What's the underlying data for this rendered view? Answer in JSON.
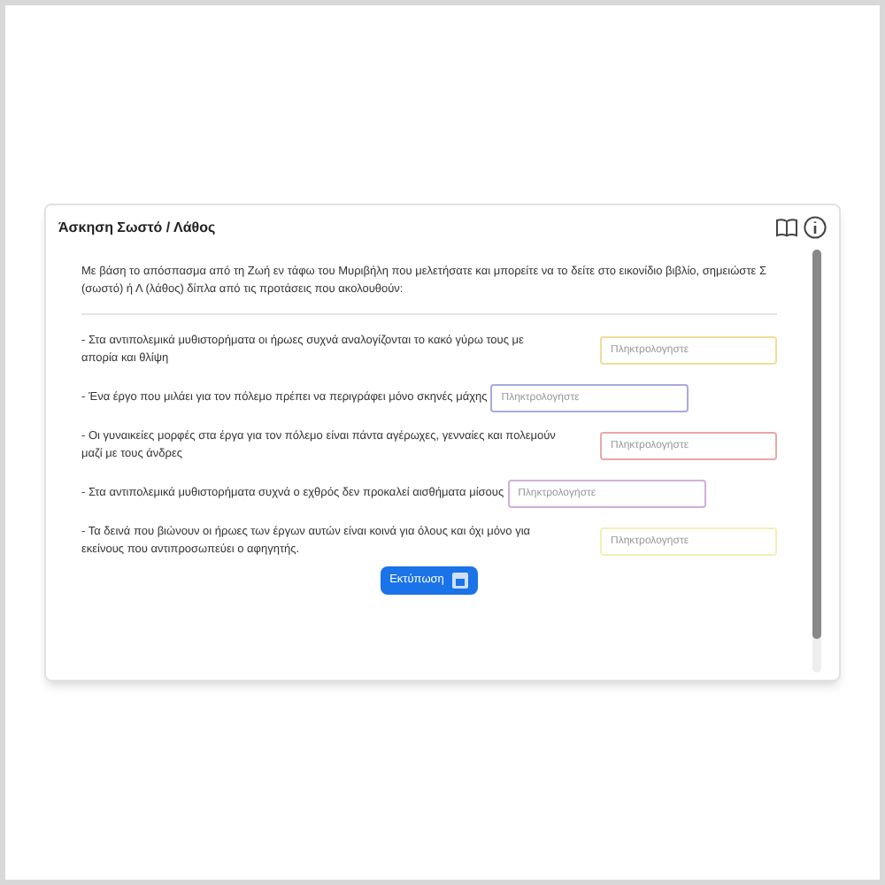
{
  "exercise": {
    "title": "Άσκηση Σωστό / Λάθος",
    "instructions": "Με βάση το απόσπασμα από τη Ζωή εν τάφω του Μυριβήλη που μελετήσατε και μπορείτε να το δείτε στο εικονίδιο βιβλίο, σημειώστε Σ (σωστό) ή Λ (λάθος) δίπλα από τις προτάσεις που ακολουθούν:",
    "statements": [
      {
        "text": "- Στα αντιπολεμικά μυθιστορήματα οι ήρωες συχνά αναλογίζονται το κακό γύρω τους με απορία και θλίψη",
        "kind": "aligned",
        "color": "#f0dc9a",
        "placeholder": "Πληκτρολογήστε"
      },
      {
        "text": "- Ένα έργο που μιλάει για τον πόλεμο πρέπει να περιγράφει μόνο σκηνές μάχης",
        "kind": "inline",
        "color": "#a9a9e0",
        "placeholder": "Πληκτρολογήστε"
      },
      {
        "text": "- Οι γυναικείες μορφές στα έργα για τον πόλεμο είναι πάντα αγέρωχες, γενναίες και πολεμούν μαζί με τους άνδρες",
        "kind": "aligned",
        "color": "#e8a8a8",
        "placeholder": "Πληκτρολογήστε"
      },
      {
        "text": "- Στα αντιπολεμικά μυθιστορήματα συχνά ο εχθρός δεν προκαλεί αισθήματα μίσους",
        "kind": "inline",
        "color": "#d0b0d8",
        "placeholder": "Πληκτρολογήστε"
      },
      {
        "text": "- Τα δεινά που βιώνουν οι ήρωες των έργων αυτών είναι κοινά για όλους και όχι μόνο για εκείνους που αντιπροσωπεύει ο αφηγητής.",
        "kind": "aligned",
        "color": "#f2f0b8",
        "placeholder": "Πληκτρολογήστε"
      }
    ],
    "print_button": "Εκτύπωση"
  }
}
